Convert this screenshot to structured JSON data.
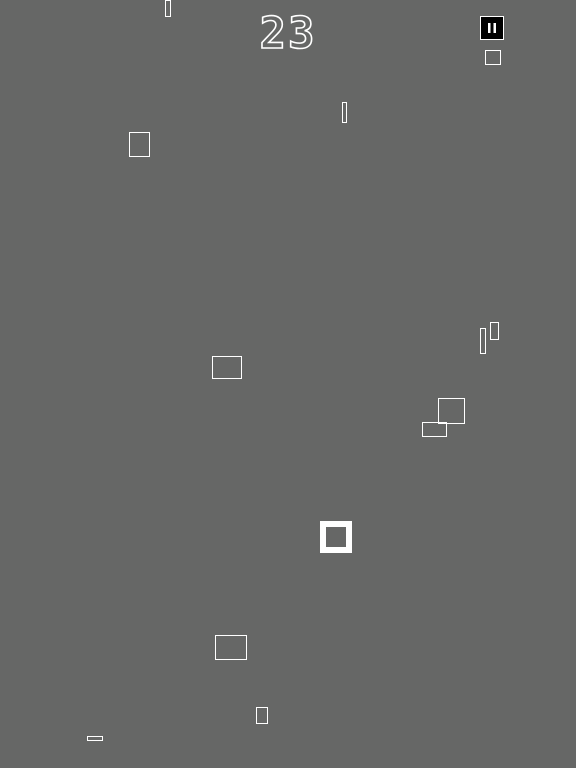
{
  "hud": {
    "score": "23",
    "pause_icon": "pause-icon"
  },
  "colors": {
    "background": "#666766",
    "stroke": "#ffffff",
    "pause_bg": "#000000"
  }
}
